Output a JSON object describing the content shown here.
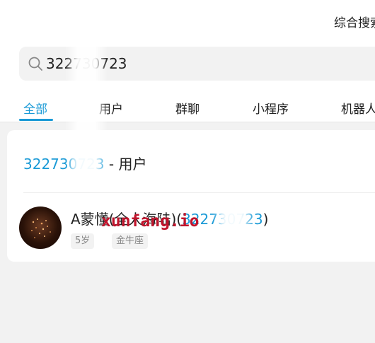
{
  "header": {
    "title": "综合搜索"
  },
  "search": {
    "query": "322730723"
  },
  "tabs": [
    {
      "label": "全部",
      "active": true
    },
    {
      "label": "用户"
    },
    {
      "label": "群聊"
    },
    {
      "label": "小程序"
    },
    {
      "label": "机器人"
    }
  ],
  "results": {
    "header_number": "322730723",
    "header_suffix": " - 用户",
    "user": {
      "name_prefix": "A蒙懂(全人海陆)(",
      "name_number": "322730723",
      "name_suffix": ")",
      "tags": [
        "5岁",
        "金牛座"
      ]
    }
  },
  "watermark": "xunfang.io",
  "colors": {
    "accent": "#1a9ad6",
    "watermark": "#c0142c"
  }
}
